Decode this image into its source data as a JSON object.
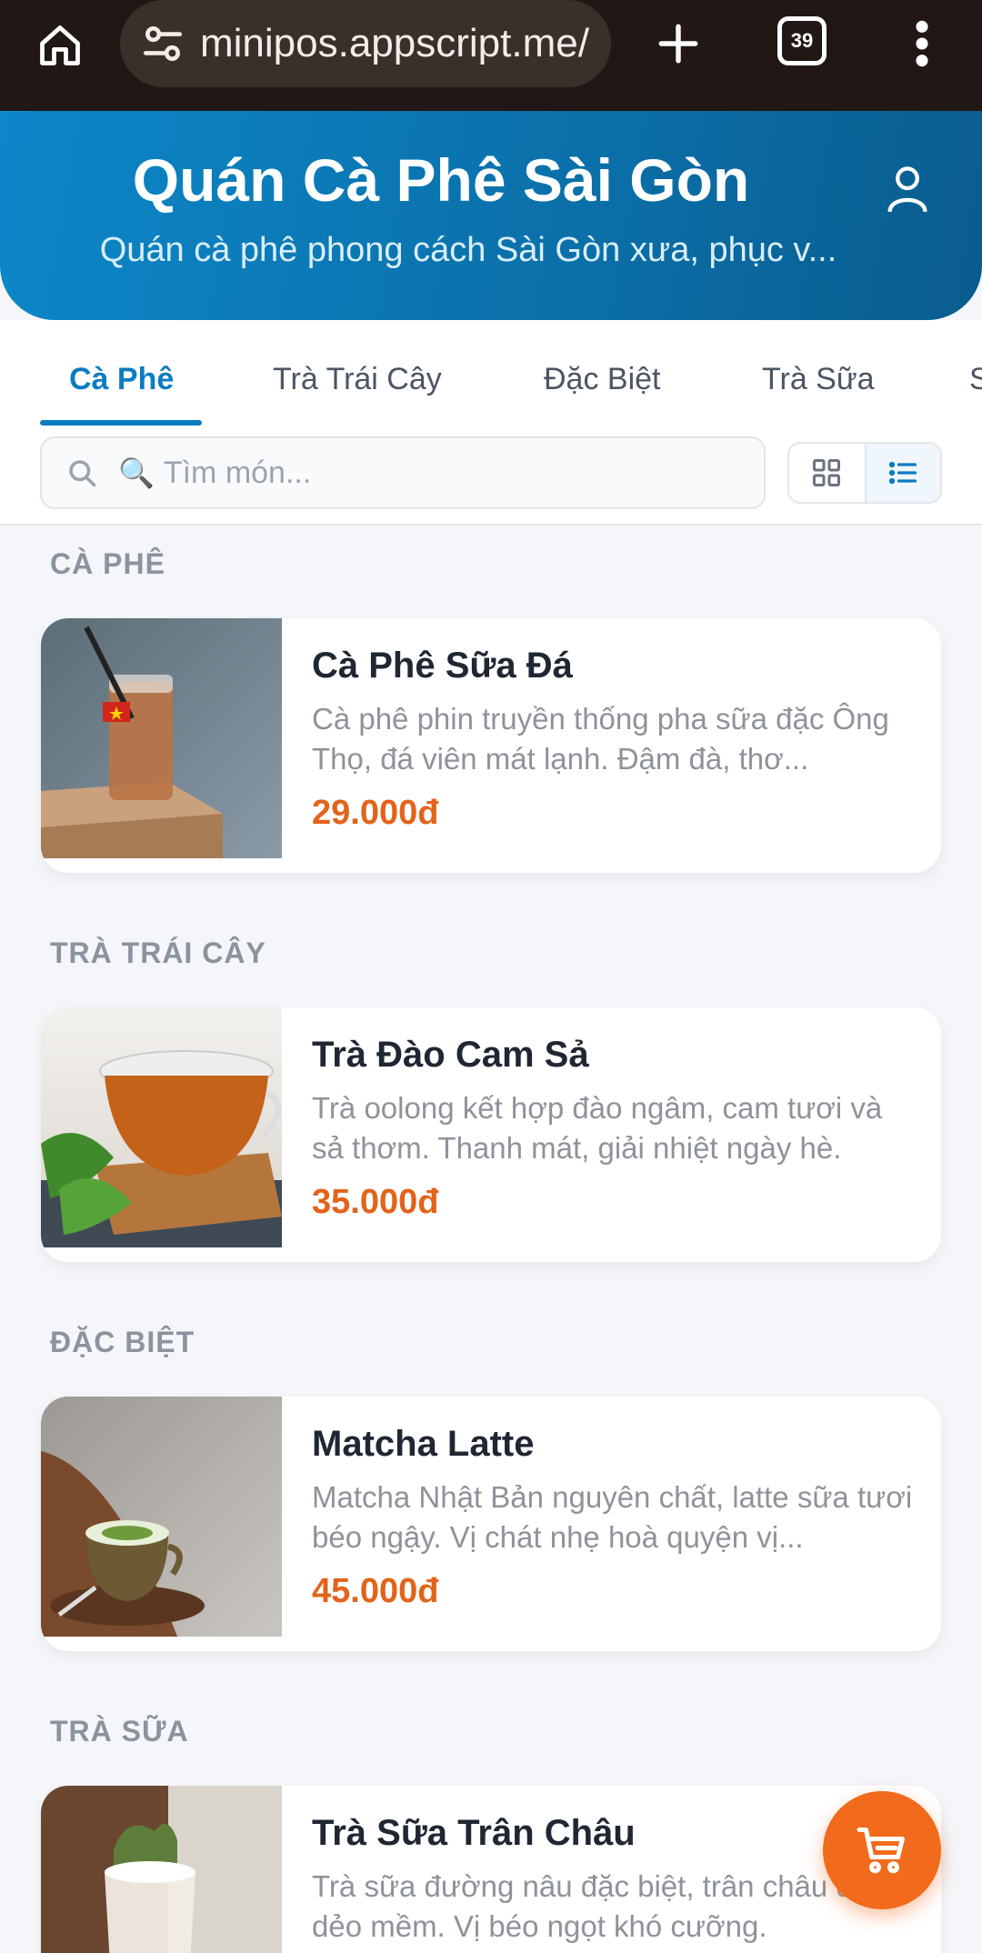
{
  "browser": {
    "url": "minipos.appscript.me/",
    "tab_count": "39"
  },
  "header": {
    "title": "Quán Cà Phê Sài Gòn",
    "subtitle": "Quán cà phê phong cách Sài Gòn xưa, phục v..."
  },
  "tabs": [
    {
      "label": "Cà Phê",
      "active": true
    },
    {
      "label": "Trà Trái Cây",
      "active": false
    },
    {
      "label": "Đặc Biệt",
      "active": false
    },
    {
      "label": "Trà Sữa",
      "active": false
    },
    {
      "label": "S",
      "active": false
    }
  ],
  "search": {
    "emoji": "🔍",
    "placeholder": "Tìm món..."
  },
  "sections": [
    {
      "label": "CÀ PHÊ",
      "item": {
        "name": "Cà Phê Sữa Đá",
        "description": "Cà phê phin truyền thống pha sữa đặc Ông Thọ, đá viên mát lạnh. Đậm đà, thơ...",
        "price": "29.000đ"
      }
    },
    {
      "label": "TRÀ TRÁI CÂY",
      "item": {
        "name": "Trà Đào Cam Sả",
        "description": "Trà oolong kết hợp đào ngâm, cam tươi và sả thơm. Thanh mát, giải nhiệt ngày hè.",
        "price": "35.000đ"
      }
    },
    {
      "label": "ĐẶC BIỆT",
      "item": {
        "name": "Matcha Latte",
        "description": "Matcha Nhật Bản nguyên chất, latte sữa tươi béo ngậy. Vị chát nhẹ hoà quyện vị...",
        "price": "45.000đ"
      }
    },
    {
      "label": "TRÀ SỮA",
      "item": {
        "name": "Trà Sữa Trân Châu",
        "description": "Trà sữa đường nâu đặc biệt, trân châu đen dẻo mềm. Vị béo ngọt khó cưỡng.",
        "price": ""
      }
    }
  ],
  "colors": {
    "accent": "#0b7cc1",
    "price": "#e3631a",
    "cart": "#f26a1b"
  }
}
